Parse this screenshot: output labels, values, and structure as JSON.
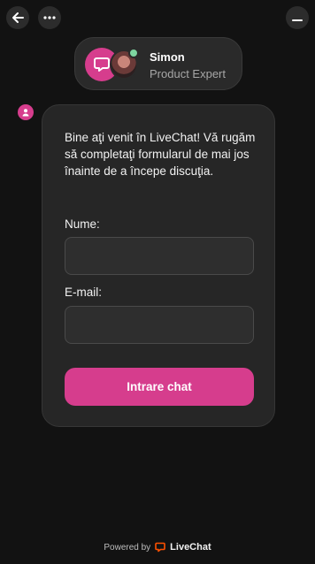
{
  "header": {
    "back_icon": "arrow-left-icon",
    "more_icon": "more-horizontal-icon",
    "minimize_icon": "minimize-icon"
  },
  "agent": {
    "name": "Simon",
    "role": "Product Expert",
    "status_color": "#7ed5a0"
  },
  "chat": {
    "welcome_text": "Bine aţi venit în LiveChat! Vă rugăm să completaţi formularul de mai jos înainte de a începe discuţia.",
    "name_label": "Nume:",
    "name_value": "",
    "email_label": "E-mail:",
    "email_value": "",
    "submit_label": "Intrare chat"
  },
  "footer": {
    "powered_by": "Powered by",
    "brand": "LiveChat"
  },
  "colors": {
    "accent": "#d63d8d",
    "background": "#121212",
    "card": "#262626",
    "brand_logo": "#ff5100"
  }
}
